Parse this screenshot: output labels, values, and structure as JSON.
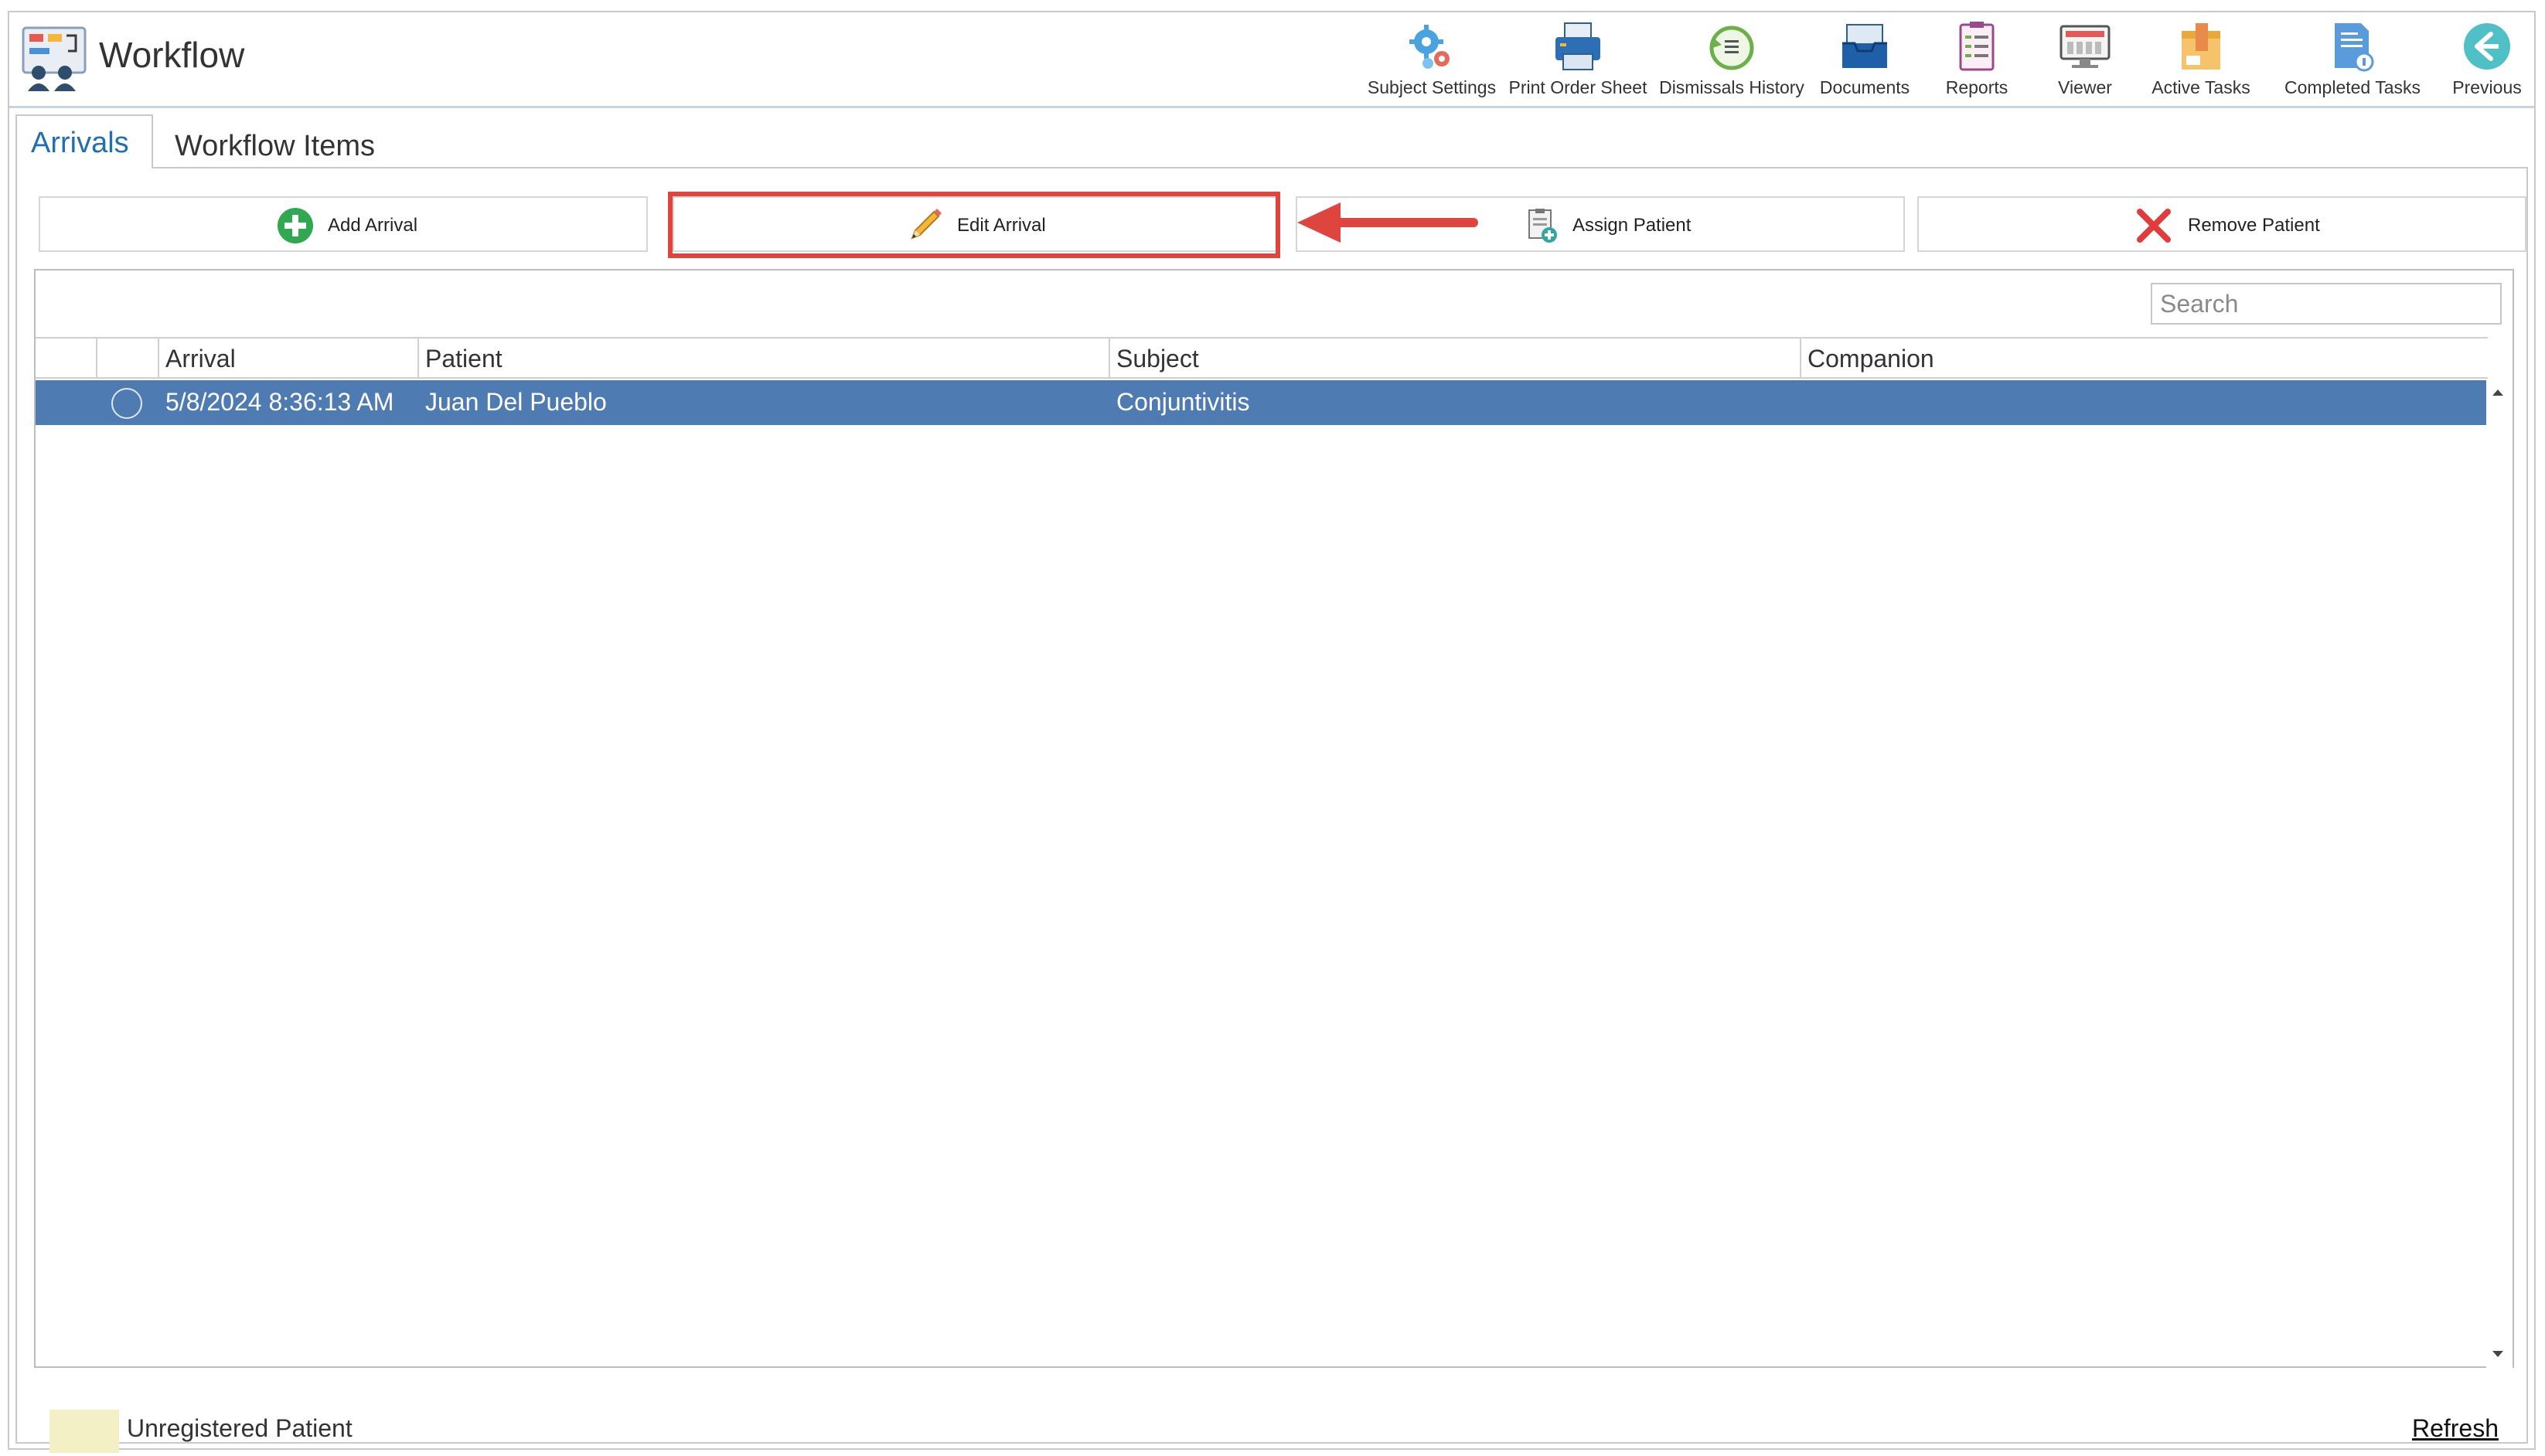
{
  "app": {
    "title": "Workflow"
  },
  "toolbar": {
    "items": [
      {
        "label": "Subject Settings",
        "icon": "gears-icon"
      },
      {
        "label": "Print Order Sheet",
        "icon": "printer-icon"
      },
      {
        "label": "Dismissals History",
        "icon": "history-icon"
      },
      {
        "label": "Documents",
        "icon": "inbox-tray-icon"
      },
      {
        "label": "Reports",
        "icon": "clipboard-icon"
      },
      {
        "label": "Viewer",
        "icon": "monitor-icon"
      },
      {
        "label": "Active Tasks",
        "icon": "active-tasks-icon"
      },
      {
        "label": "Completed Tasks",
        "icon": "completed-tasks-icon"
      },
      {
        "label": "Previous",
        "icon": "back-arrow-icon"
      }
    ]
  },
  "tabs": [
    {
      "label": "Arrivals",
      "active": true
    },
    {
      "label": "Workflow Items",
      "active": false
    }
  ],
  "actions": {
    "add": "Add Arrival",
    "edit": "Edit Arrival",
    "assign": "Assign Patient",
    "remove": "Remove Patient"
  },
  "search": {
    "placeholder": "Search"
  },
  "table": {
    "columns": [
      "Arrival",
      "Patient",
      "Subject",
      "Companion"
    ],
    "rows": [
      {
        "arrival": "5/8/2024 8:36:13 AM",
        "patient": "Juan Del Pueblo",
        "subject": "Conjuntivitis",
        "companion": ""
      }
    ]
  },
  "footer": {
    "legend_label": "Unregistered Patient",
    "refresh": "Refresh"
  },
  "colors": {
    "selected_row": "#4f7bb3",
    "active_tab": "#1f6fb2",
    "highlight": "#e0443e",
    "unregistered_swatch": "#f2f0c4"
  }
}
